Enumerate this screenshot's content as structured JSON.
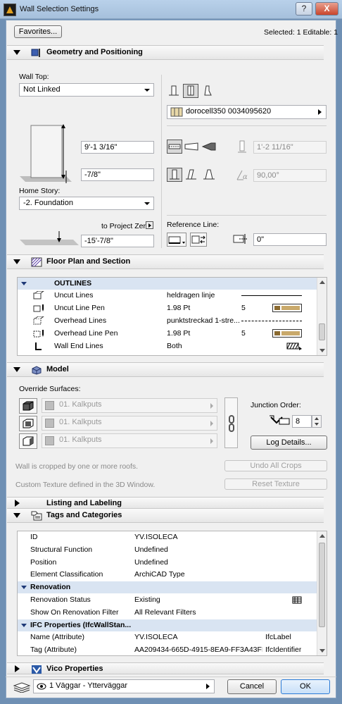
{
  "window": {
    "title": "Wall Selection Settings",
    "help": "?",
    "close": "X"
  },
  "top": {
    "favorites": "Favorites...",
    "selected": "Selected: 1 Editable: 1"
  },
  "geometry": {
    "title": "Geometry and Positioning",
    "wall_top_label": "Wall Top:",
    "wall_top_value": "Not Linked",
    "height": "9'-1 3/16\"",
    "base_offset": "-7/8\"",
    "home_story_label": "Home Story:",
    "home_story_value": "-2. Foundation",
    "to_project_zero": "to Project Zero",
    "project_zero_value": "-15'-7/8\"",
    "composite": "dorocell350 0034095620",
    "thickness": "1'-2 11/16\"",
    "angle": "90,00°",
    "reference_line_label": "Reference Line:",
    "ref_offset": "0\""
  },
  "floorplan": {
    "title": "Floor Plan and Section",
    "group": "OUTLINES",
    "rows": [
      {
        "name": "Uncut Lines",
        "value": "heldragen linje",
        "num": ""
      },
      {
        "name": "Uncut Line Pen",
        "value": "1.98 Pt",
        "num": "5"
      },
      {
        "name": "Overhead Lines",
        "value": "punktstreckad 1-stre...",
        "num": ""
      },
      {
        "name": "Overhead Line Pen",
        "value": "1.98 Pt",
        "num": "5"
      },
      {
        "name": "Wall End Lines",
        "value": "Both",
        "num": ""
      }
    ]
  },
  "model": {
    "title": "Model",
    "override_label": "Override Surfaces:",
    "surfaces": [
      "01. Kalkputs",
      "01. Kalkputs",
      "01. Kalkputs"
    ],
    "junction_label": "Junction Order:",
    "junction_value": "8",
    "log_details": "Log Details...",
    "cropped_text": "Wall is cropped by one or more roofs.",
    "undo_crops": "Undo All Crops",
    "texture_text": "Custom Texture defined in the 3D Window.",
    "reset_texture": "Reset Texture"
  },
  "listing": {
    "title": "Listing and Labeling"
  },
  "tags": {
    "title": "Tags and Categories",
    "rows": [
      {
        "type": "item",
        "name": "ID",
        "value": "YV.ISOLECA",
        "extra": ""
      },
      {
        "type": "item",
        "name": "Structural Function",
        "value": "Undefined",
        "extra": ""
      },
      {
        "type": "item",
        "name": "Position",
        "value": "Undefined",
        "extra": ""
      },
      {
        "type": "item",
        "name": "Element Classification",
        "value": "ArchiCAD Type",
        "extra": ""
      },
      {
        "type": "group",
        "name": "Renovation",
        "value": "",
        "extra": ""
      },
      {
        "type": "item",
        "name": "Renovation Status",
        "value": "Existing",
        "extra": ""
      },
      {
        "type": "item",
        "name": "Show On Renovation Filter",
        "value": "All Relevant Filters",
        "extra": ""
      },
      {
        "type": "group",
        "name": "IFC Properties (IfcWallStan...",
        "value": "",
        "extra": ""
      },
      {
        "type": "item",
        "name": "Name (Attribute)",
        "value": "YV.ISOLECA",
        "extra": "IfcLabel"
      },
      {
        "type": "item",
        "name": "Tag (Attribute)",
        "value": "AA209434-665D-4915-8EA9-FF3A43FB...",
        "extra": "IfcIdentifier"
      }
    ]
  },
  "vico": {
    "title": "Vico Properties"
  },
  "bottom": {
    "layer": "1 Väggar - Ytterväggar",
    "cancel": "Cancel",
    "ok": "OK"
  }
}
